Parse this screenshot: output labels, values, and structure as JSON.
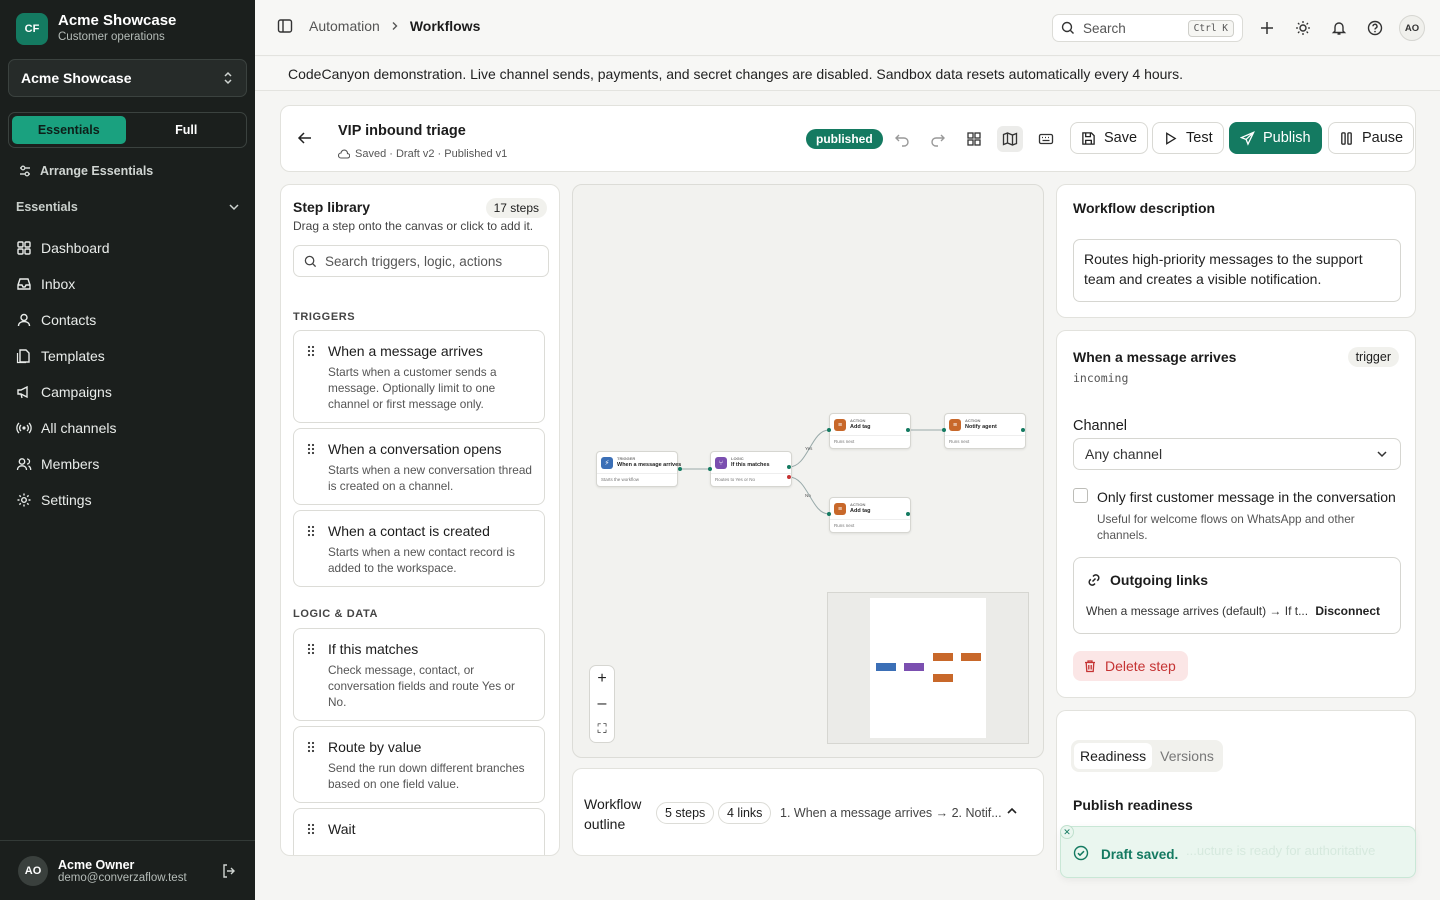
{
  "sidebar": {
    "brand_logo": "CF",
    "brand_name": "Acme Showcase",
    "brand_sub": "Customer operations",
    "workspace": "Acme Showcase",
    "modes": [
      "Essentials",
      "Full"
    ],
    "arrange": "Arrange Essentials",
    "section": "Essentials",
    "items": [
      {
        "label": "Dashboard",
        "icon": "grid-icon"
      },
      {
        "label": "Inbox",
        "icon": "inbox-icon"
      },
      {
        "label": "Contacts",
        "icon": "user-icon"
      },
      {
        "label": "Templates",
        "icon": "file-icon"
      },
      {
        "label": "Campaigns",
        "icon": "megaphone-icon"
      },
      {
        "label": "All channels",
        "icon": "radio-icon"
      },
      {
        "label": "Members",
        "icon": "users-icon"
      },
      {
        "label": "Settings",
        "icon": "gear-icon"
      }
    ],
    "user": {
      "initials": "AO",
      "name": "Acme Owner",
      "email": "demo@converzaflow.test"
    }
  },
  "topbar": {
    "breadcrumb": [
      "Automation",
      "Workflows"
    ],
    "search_placeholder": "Search",
    "search_kbd": "Ctrl K",
    "avatar": "AO"
  },
  "banner": "CodeCanyon demonstration. Live channel sends, payments, and secret changes are disabled. Sandbox data resets automatically every 4 hours.",
  "workflow": {
    "title": "VIP inbound triage",
    "meta": "Saved · Draft v2 · Published v1",
    "status": "published",
    "buttons": {
      "save": "Save",
      "test": "Test",
      "publish": "Publish",
      "pause": "Pause"
    }
  },
  "library": {
    "title": "Step library",
    "count": "17 steps",
    "subtitle": "Drag a step onto the canvas or click to add it.",
    "search_placeholder": "Search triggers, logic, actions",
    "categories": [
      {
        "name": "TRIGGERS",
        "steps": [
          {
            "title": "When a message arrives",
            "desc": "Starts when a customer sends a message. Optionally limit to one channel or first message only."
          },
          {
            "title": "When a conversation opens",
            "desc": "Starts when a new conversation thread is created on a channel."
          },
          {
            "title": "When a contact is created",
            "desc": "Starts when a new contact record is added to the workspace."
          }
        ]
      },
      {
        "name": "LOGIC & DATA",
        "steps": [
          {
            "title": "If this matches",
            "desc": "Check message, contact, or conversation fields and route Yes or No."
          },
          {
            "title": "Route by value",
            "desc": "Send the run down different branches based on one field value."
          },
          {
            "title": "Wait",
            "desc": ""
          }
        ]
      }
    ]
  },
  "canvas": {
    "nodes": [
      {
        "kind": "TRIGGER",
        "title": "When a message arrives",
        "desc": "Starts the workflow",
        "color": "#3b6fb6"
      },
      {
        "kind": "LOGIC",
        "title": "If this matches",
        "desc": "Routes to Yes or No",
        "color": "#7b4fb0"
      },
      {
        "kind": "ACTION",
        "title": "Add tag",
        "desc": "Runs next",
        "color": "#c8682a"
      },
      {
        "kind": "ACTION",
        "title": "Notify agent",
        "desc": "Runs next",
        "color": "#c8682a"
      },
      {
        "kind": "ACTION",
        "title": "Add tag",
        "desc": "Runs next",
        "color": "#c8682a"
      }
    ],
    "edge_labels": [
      "Yes",
      "No"
    ],
    "zoom": [
      "+",
      "–",
      "⛶"
    ]
  },
  "outline": {
    "title": "Workflow outline",
    "steps": "5 steps",
    "links": "4 links",
    "summary": "1. When a message arrives → 2. Notif..."
  },
  "panel": {
    "desc_title": "Workflow description",
    "description": "Routes high-priority messages to the support team and creates a visible notification.",
    "step_title": "When a message arrives",
    "step_tag": "trigger",
    "step_code": "incoming",
    "channel_label": "Channel",
    "channel_value": "Any channel",
    "first_only_label": "Only first customer message in the conversation",
    "first_only_help": "Useful for welcome flows on WhatsApp and other channels.",
    "links_title": "Outgoing links",
    "link_row": "When a message arrives (default) → If t...",
    "disconnect": "Disconnect",
    "delete": "Delete step",
    "tabs": [
      "Readiness",
      "Versions"
    ],
    "readiness_title": "Publish readiness",
    "readiness_text": "...ucture is ready for authoritative"
  },
  "toast": "Draft saved.",
  "colors": {
    "accent": "#147a61",
    "danger": "#c53333",
    "sidebar": "#1b1f1d"
  }
}
